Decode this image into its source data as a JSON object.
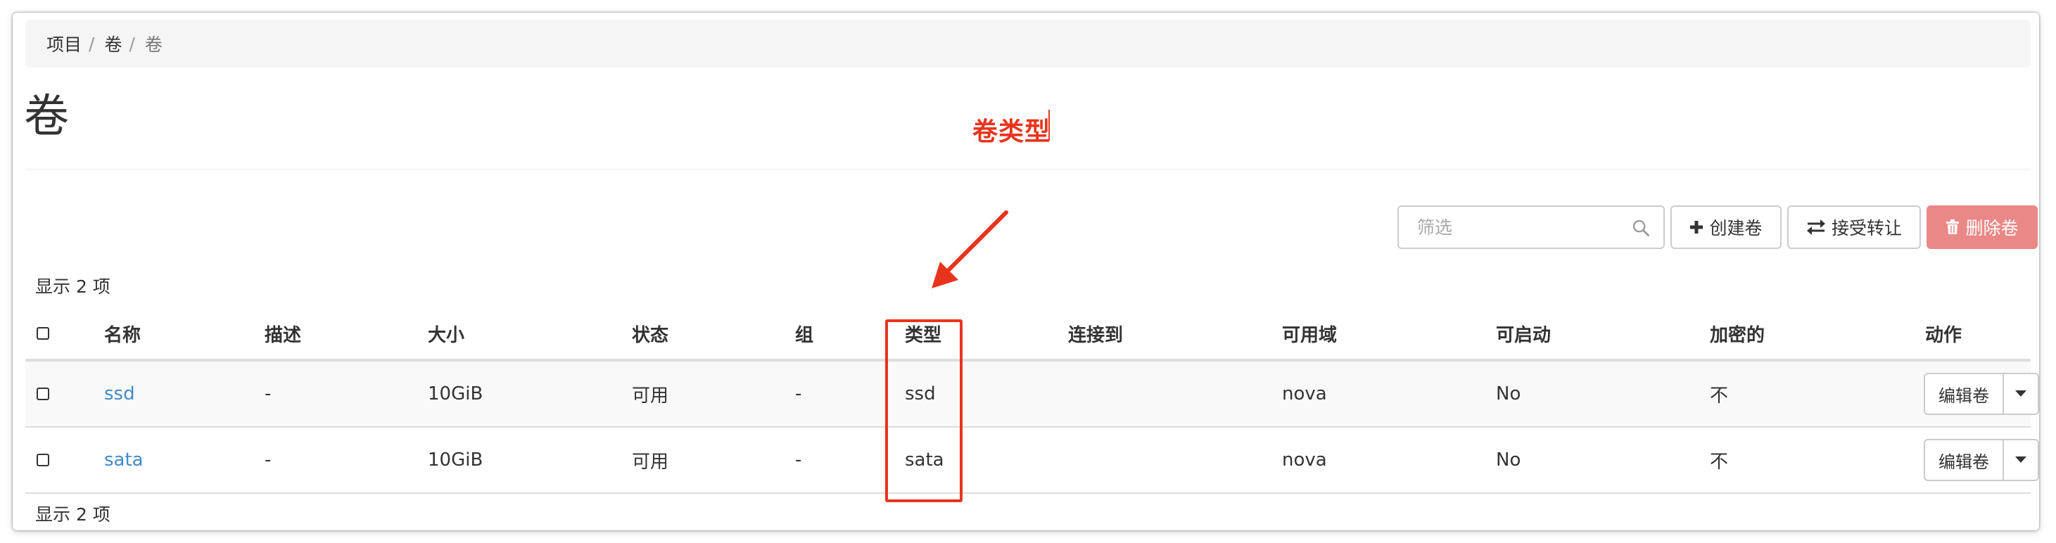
{
  "breadcrumb": {
    "items": [
      "项目",
      "卷",
      "卷"
    ]
  },
  "page": {
    "title": "卷"
  },
  "annotation": {
    "label": "卷类型",
    "color": "#e8341c"
  },
  "toolbar": {
    "filter_placeholder": "筛选",
    "create_label": "创建卷",
    "transfer_label": "接受转让",
    "delete_label": "删除卷"
  },
  "summary": {
    "top": "显示 2 项",
    "bottom": "显示 2 项"
  },
  "table": {
    "headers": [
      "名称",
      "描述",
      "大小",
      "状态",
      "组",
      "类型",
      "连接到",
      "可用域",
      "可启动",
      "加密的",
      "动作"
    ],
    "rows": [
      {
        "name": "ssd",
        "description": "-",
        "size": "10GiB",
        "status": "可用",
        "group": "-",
        "type": "ssd",
        "attached_to": "",
        "zone": "nova",
        "bootable": "No",
        "encrypted": "不",
        "action": "编辑卷"
      },
      {
        "name": "sata",
        "description": "-",
        "size": "10GiB",
        "status": "可用",
        "group": "-",
        "type": "sata",
        "attached_to": "",
        "zone": "nova",
        "bootable": "No",
        "encrypted": "不",
        "action": "编辑卷"
      }
    ]
  },
  "colors": {
    "link": "#428bca",
    "danger_button": "#e98886",
    "highlight": "#e8341c"
  }
}
